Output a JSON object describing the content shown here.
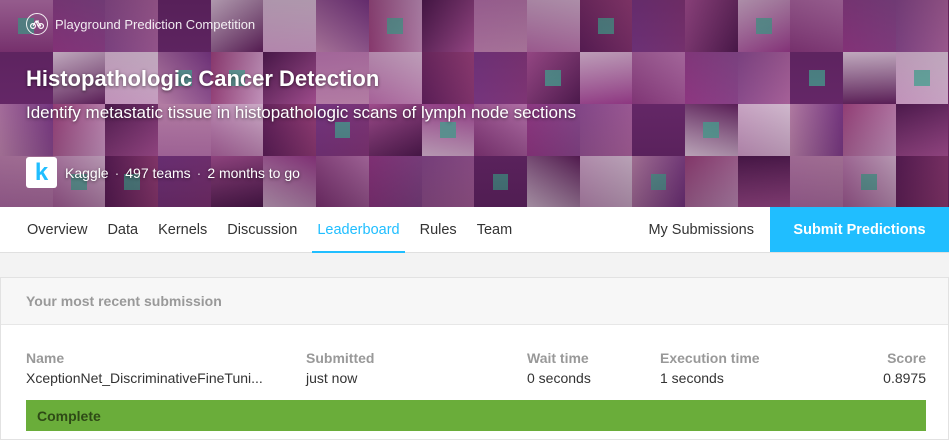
{
  "header": {
    "competition_type": "Playground Prediction Competition",
    "title": "Histopathologic Cancer Detection",
    "subtitle": "Identify metastatic tissue in histopathologic scans of lymph node sections",
    "host_logo_letter": "k",
    "host": "Kaggle",
    "teams": "497 teams",
    "deadline": "2 months to go"
  },
  "nav": {
    "tabs": [
      "Overview",
      "Data",
      "Kernels",
      "Discussion",
      "Leaderboard",
      "Rules",
      "Team"
    ],
    "active_tab": "Leaderboard",
    "my_submissions": "My Submissions",
    "submit": "Submit Predictions"
  },
  "submission": {
    "panel_title": "Your most recent submission",
    "columns": {
      "name": "Name",
      "submitted": "Submitted",
      "wait_time": "Wait time",
      "execution_time": "Execution time",
      "score": "Score"
    },
    "values": {
      "name": "XceptionNet_DiscriminativeFineTuni...",
      "submitted": "just now",
      "wait_time": "0 seconds",
      "execution_time": "1 seconds",
      "score": "0.8975"
    },
    "status": "Complete"
  },
  "colors": {
    "accent": "#20beff",
    "status_green": "#6aad3a",
    "banner_base": "#7a2a6a"
  }
}
